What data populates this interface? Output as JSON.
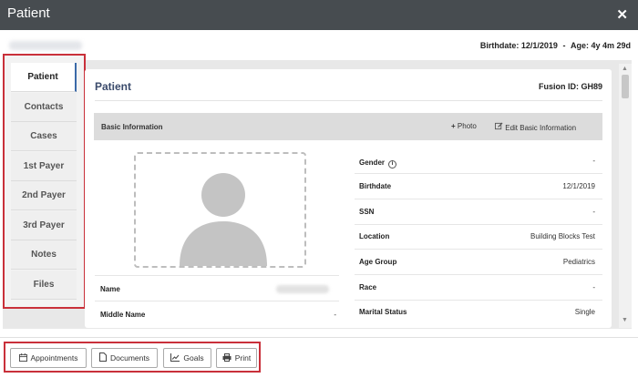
{
  "window": {
    "title": "Patient",
    "close_icon": "close-icon"
  },
  "header": {
    "birthdate_text": "Birthdate: 12/1/2019",
    "separator": "-",
    "age_text": "Age: 4y 4m 29d"
  },
  "tabs": [
    {
      "label": "Patient"
    },
    {
      "label": "Contacts"
    },
    {
      "label": "Cases"
    },
    {
      "label": "1st Payer"
    },
    {
      "label": "2nd Payer"
    },
    {
      "label": "3rd Payer"
    },
    {
      "label": "Notes"
    },
    {
      "label": "Files"
    }
  ],
  "card": {
    "title": "Patient",
    "fusion_label": "Fusion ID:",
    "fusion_id": "GH89"
  },
  "basic": {
    "title": "Basic Information",
    "photo_button": "Photo",
    "edit_button": "Edit Basic Information"
  },
  "left_fields": {
    "name_label": "Name",
    "middle_label": "Middle Name",
    "middle_value": "-"
  },
  "right_fields": [
    {
      "label": "Gender",
      "value": "-"
    },
    {
      "label": "Birthdate",
      "value": "12/1/2019"
    },
    {
      "label": "SSN",
      "value": "-"
    },
    {
      "label": "Location",
      "value": "Building Blocks Test"
    },
    {
      "label": "Age Group",
      "value": "Pediatrics"
    },
    {
      "label": "Race",
      "value": "-"
    },
    {
      "label": "Marital Status",
      "value": "Single"
    }
  ],
  "footer": {
    "appointments": "Appointments",
    "documents": "Documents",
    "goals": "Goals",
    "print": "Print"
  },
  "colors": {
    "titlebar": "#474c50",
    "highlight": "#c9303a",
    "card_title": "#3a4a6b",
    "active_tab_indicator": "#3b6aa8"
  }
}
